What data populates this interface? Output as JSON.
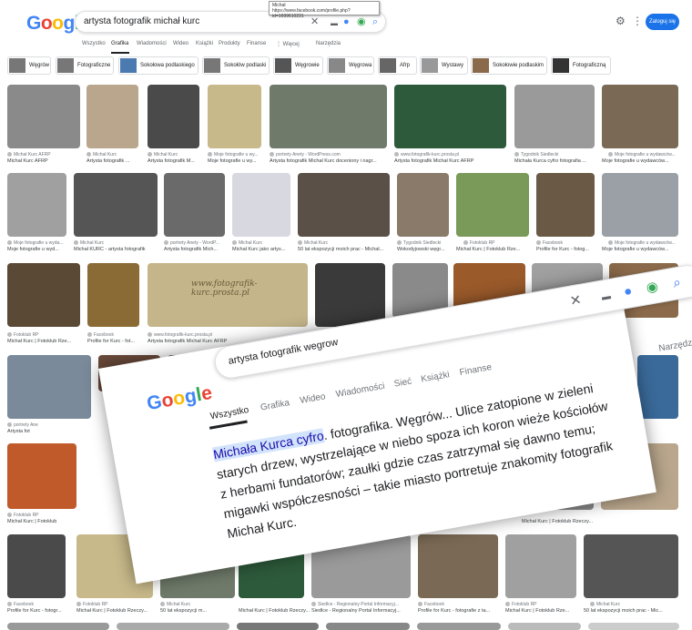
{
  "header": {
    "logo": [
      "G",
      "o",
      "o",
      "g",
      "l",
      "e"
    ],
    "query": "artysta fotografik michał kurc",
    "login": "Zaloguj się",
    "tooltip_title": "Michał",
    "tooltip_url": "https://www.facebook.com/profile.php?id=1699610231"
  },
  "tabs": [
    "Wszystko",
    "Grafika",
    "Wiadomości",
    "Wideo",
    "Książki",
    "Produkty",
    "Finanse",
    "⋮ Więcej",
    "Narzędzia"
  ],
  "chips": [
    "Węgrów",
    "Fotograficzne",
    "Sokołowa podlaskiego",
    "Sokołów podlaski",
    "Węgrowie",
    "Węgrowa",
    "Afrp",
    "Wystawy",
    "Sokołowie podlaskim",
    "Fotograficzną"
  ],
  "results": [
    {
      "src": "Michał Kurc AFRP",
      "cap": "Michał Kurc AFRP",
      "color": "#8a8a8a"
    },
    {
      "src": "Michał Kurc",
      "cap": "Artysta fotografik ...",
      "color": "#b9a68c"
    },
    {
      "src": "Michał Kurc",
      "cap": "Artysta fotografik M...",
      "color": "#4a4a4a"
    },
    {
      "src": "Moje fotografie u wy...",
      "cap": "Moje fotografie u wy...",
      "color": "#c8b98a"
    },
    {
      "src": "portrety Anety - WordPress.com",
      "cap": "Artysta fotografik Michał Kurc doceniony i nagr...",
      "color": "#6f7a6a"
    },
    {
      "src": "www.fotografik-kurc.prosta.pl",
      "cap": "Artysta fotografik Michał Kurc AFRP",
      "color": "#2d5a3a"
    },
    {
      "src": "Tygodnik Siedlecki",
      "cap": "Michała Kurca cyfro fotografia ...",
      "color": "#9a9a9a"
    },
    {
      "src": "Moje fotografie u wydawców...",
      "cap": "Moje fotografie u wydawców...",
      "color": "#7a6a55"
    },
    {
      "src": "Moje fotografie u wyda...",
      "cap": "Moje fotografie u wyd...",
      "color": "#a0a0a0"
    },
    {
      "src": "Michał Kurc",
      "cap": "Michał KURC - artysta fotografik",
      "color": "#555555"
    },
    {
      "src": "portrety Anety - WordP...",
      "cap": "Artysta fotografik Mich...",
      "color": "#6a6a6a"
    },
    {
      "src": "Michał Kurc",
      "cap": "Michał Kurc jako artys...",
      "color": "#d8d8e0"
    },
    {
      "src": "Michał Kurc",
      "cap": "50 lat ekspozycji moich prac - Michał...",
      "color": "#5a5048"
    },
    {
      "src": "Tygodnik Siedlecki",
      "cap": "Wokodyjowski węgr...",
      "color": "#8a7a6a"
    },
    {
      "src": "Fotoklub RP",
      "cap": "Michał Kurc | Fotoklub Rze...",
      "color": "#7a9a5a"
    },
    {
      "src": "Facebook",
      "cap": "Profile for Kurc - fotog...",
      "color": "#6a5a45"
    },
    {
      "src": "Moje fotografie u wydawców...",
      "cap": "Moje fotografie u wydawców...",
      "color": "#9aa0a5"
    },
    {
      "src": "Fotoklub RP",
      "cap": "Michał Kurc | Fotoklub Rze...",
      "color": "#5a4a35"
    },
    {
      "src": "Facebook",
      "cap": "Profile for Kurc - fot...",
      "color": "#8a6a35"
    },
    {
      "src": "www.fotografik-kurc.prosta.pl",
      "cap": "Artysta fotografik Michał Kurc AFRP",
      "color": "#c4b58a"
    },
    {
      "src": "Fotoklub RP",
      "cap": "",
      "color": "#3a3a3a"
    },
    {
      "src": "portrety Ane",
      "cap": "Artysta fot",
      "color": "#8a8a8a"
    },
    {
      "src": "Fotoklub RP",
      "cap": "Michał Kurc | Fotoklub",
      "color": "#9a5a2a"
    },
    {
      "src": "Facebook",
      "cap": "Profile for Kurc - fotogr...",
      "color": "#a0a0a0"
    },
    {
      "src": "Fotoklub RP",
      "cap": "Michał Kurc | Fotoklub Rzeczy...",
      "color": "#8a6a4a"
    },
    {
      "src": "Michał Kurc",
      "cap": "50 lat ekspozycji m...",
      "color": "#7a8a9a"
    },
    {
      "src": "Michał Kurc",
      "cap": "Michał Kurc | Fotoklub Rzeczy...",
      "color": "#6a4a3a"
    },
    {
      "src": "Siedlce - Regionalny Portal Informacyj...",
      "cap": "Siedlce - Regionalny Portal Informacyj...",
      "color": "#4a5a6a"
    },
    {
      "src": "Facebook",
      "cap": "Profile for Kurc - fotografie z ta...",
      "color": "#3a6a9a"
    },
    {
      "src": "Fotoklub RP",
      "cap": "Michał Kurc | Fotoklub Rze...",
      "color": "#c05a2a"
    },
    {
      "src": "Michał Kurc",
      "cap": "50 lat ekspozycji moich prac - Mic...",
      "color": "#5a5a5a"
    }
  ],
  "overlay": {
    "logo": [
      "G",
      "o",
      "o",
      "g",
      "l",
      "e"
    ],
    "query": "artysta fotografik wegrow",
    "tabs": [
      "Wszystko",
      "Grafika",
      "Wideo",
      "Wiadomości",
      "Sieć",
      "Książki",
      "Finanse"
    ],
    "tools": "Narzędzia",
    "highlight": "Michała Kurca cyfro",
    "snippet": ". fotografika. Węgrów... Ulice zatopione w zieleni starych drzew, wystrzelające w niebo spoza ich koron wieże kościołów z herbami fundatorów; zaułki gdzie czas zatrzymał się dawno temu; migawki współczesności – takie miasto portretuje znakomity fotografik Michał Kurc."
  }
}
